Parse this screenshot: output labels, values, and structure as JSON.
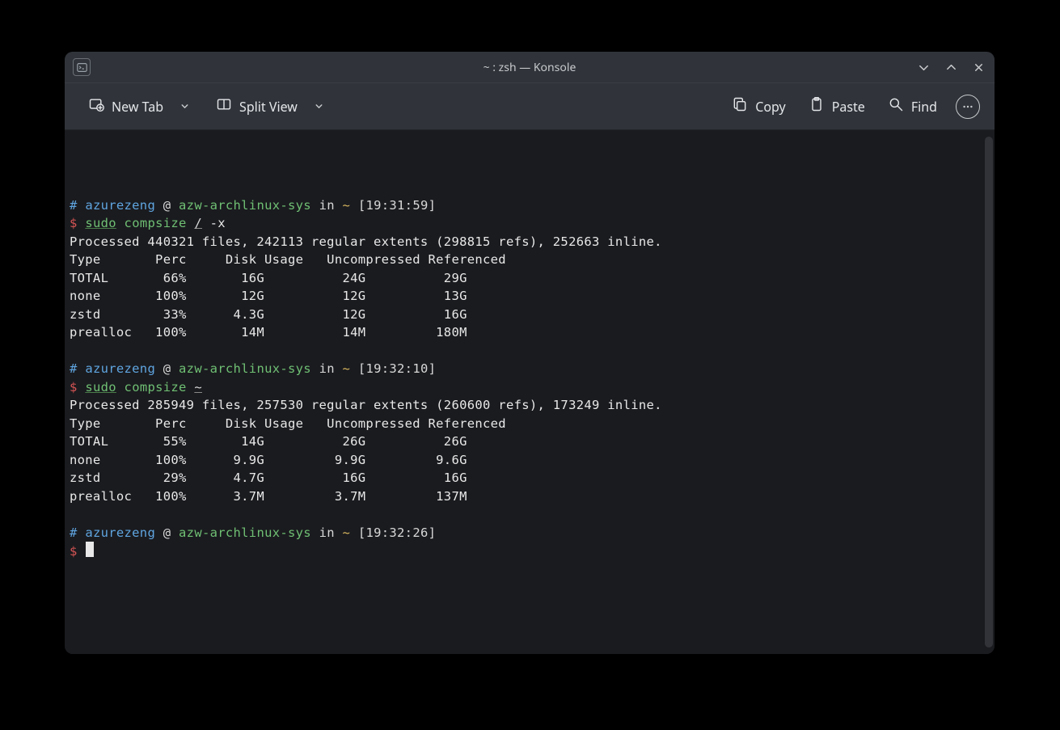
{
  "window": {
    "title": "~ : zsh — Konsole"
  },
  "toolbar": {
    "new_tab": "New Tab",
    "split_view": "Split View",
    "copy": "Copy",
    "paste": "Paste",
    "find": "Find"
  },
  "terminal": {
    "blocks": [
      {
        "prompt": {
          "hash": "#",
          "user": "azurezeng",
          "at": " @ ",
          "host": "azw-archlinux-sys",
          "in_word": " in ",
          "path": "~",
          "time": "[19:31:59]"
        },
        "command": {
          "dollar": "$",
          "sudo": "sudo",
          "cmd": "compsize",
          "arg": "/",
          "flags": "-x"
        },
        "output": [
          "Processed 440321 files, 242113 regular extents (298815 refs), 252663 inline.",
          "Type       Perc     Disk Usage   Uncompressed Referenced",
          "TOTAL       66%       16G          24G          29G",
          "none       100%       12G          12G          13G",
          "zstd        33%      4.3G          12G          16G",
          "prealloc   100%       14M          14M         180M"
        ]
      },
      {
        "prompt": {
          "hash": "#",
          "user": "azurezeng",
          "at": " @ ",
          "host": "azw-archlinux-sys",
          "in_word": " in ",
          "path": "~",
          "time": "[19:32:10]"
        },
        "command": {
          "dollar": "$",
          "sudo": "sudo",
          "cmd": "compsize",
          "arg": "~",
          "flags": ""
        },
        "output": [
          "Processed 285949 files, 257530 regular extents (260600 refs), 173249 inline.",
          "Type       Perc     Disk Usage   Uncompressed Referenced",
          "TOTAL       55%       14G          26G          26G",
          "none       100%      9.9G         9.9G         9.6G",
          "zstd        29%      4.7G          16G          16G",
          "prealloc   100%      3.7M         3.7M         137M"
        ]
      },
      {
        "prompt": {
          "hash": "#",
          "user": "azurezeng",
          "at": " @ ",
          "host": "azw-archlinux-sys",
          "in_word": " in ",
          "path": "~",
          "time": "[19:32:26]"
        },
        "command": {
          "dollar": "$",
          "sudo": "",
          "cmd": "",
          "arg": "",
          "flags": ""
        },
        "output": [],
        "cursor": true
      }
    ]
  }
}
